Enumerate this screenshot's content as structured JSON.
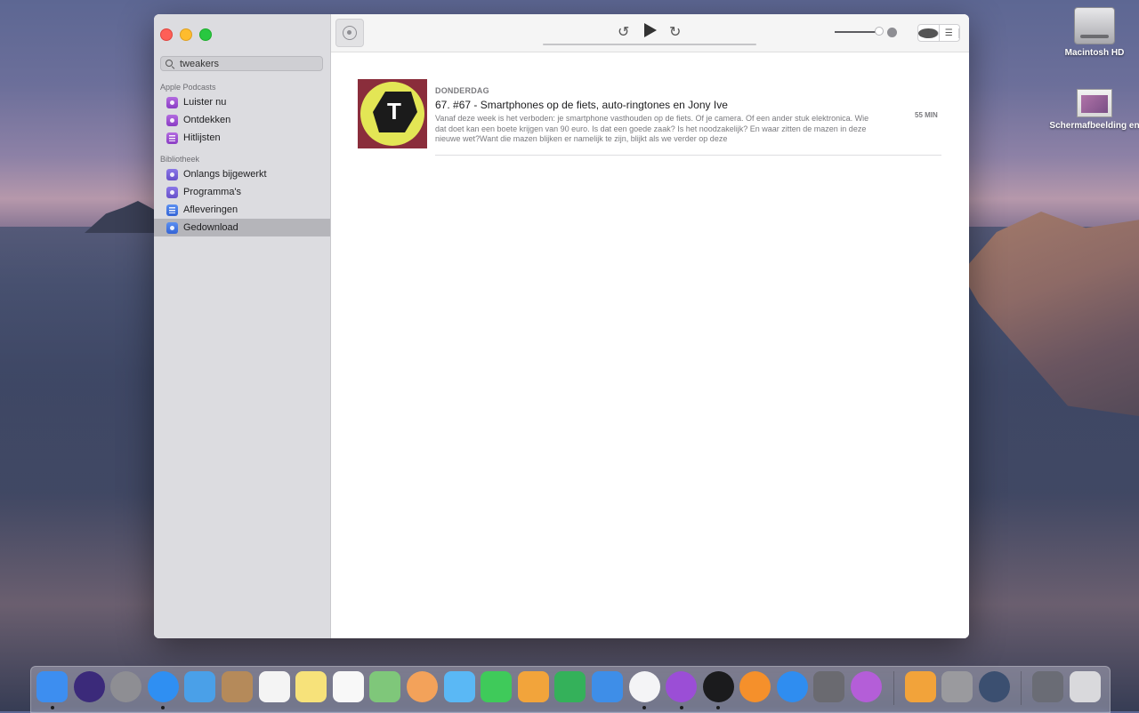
{
  "window": {
    "search_value": "tweakers",
    "sidebar": {
      "section_apple": "Apple Podcasts",
      "apple_items": [
        {
          "label": "Luister nu",
          "icon": "play-circle-icon"
        },
        {
          "label": "Ontdekken",
          "icon": "podcast-icon"
        },
        {
          "label": "Hitlijsten",
          "icon": "list-icon"
        }
      ],
      "section_library": "Bibliotheek",
      "library_items": [
        {
          "label": "Onlangs bijgewerkt",
          "icon": "clock-icon"
        },
        {
          "label": "Programma's",
          "icon": "shows-icon"
        },
        {
          "label": "Afleveringen",
          "icon": "episodes-icon"
        },
        {
          "label": "Gedownload",
          "icon": "download-icon",
          "selected": true
        }
      ]
    },
    "toolbar": {
      "skip_back_icon": "↺",
      "skip_forward_icon": "↻",
      "info_icon": "i",
      "list_icon": "☰"
    },
    "episode": {
      "day": "DONDERDAG",
      "title": "67. #67 - Smartphones op de fiets, auto-ringtones en Jony Ive",
      "description": "Vanaf deze week is het verboden: je smartphone vasthouden op de fiets. Of je camera. Of een ander stuk elektronica. Wie dat doet kan een boete krijgen van 90 euro. Is dat een goede zaak? Is het noodzakelijk? En waar zitten de mazen in deze nieuwe wet?Want die mazen blijken er namelijk te zijn, blijkt als we verder op deze",
      "duration": "55 MIN",
      "artwork_letter": "T"
    }
  },
  "desktop": {
    "icons": [
      {
        "label": "Macintosh HD",
        "icon": "hard-drive-icon"
      },
      {
        "label": "Schermafbeelding en",
        "icon": "screenshot-icon"
      }
    ]
  },
  "dock": {
    "apps": [
      {
        "name": "finder",
        "color": "#3d8ef0",
        "running": true
      },
      {
        "name": "siri",
        "color": "#3b2a7a",
        "running": false,
        "round": true
      },
      {
        "name": "launchpad",
        "color": "#8e8e93",
        "running": false,
        "round": true
      },
      {
        "name": "safari",
        "color": "#2f8ff2",
        "running": true,
        "round": true
      },
      {
        "name": "mail",
        "color": "#4aa0e8",
        "running": false
      },
      {
        "name": "contacts",
        "color": "#b58a5a",
        "running": false
      },
      {
        "name": "calendar",
        "color": "#f4f4f4",
        "running": false
      },
      {
        "name": "notes",
        "color": "#f7e27a",
        "running": false
      },
      {
        "name": "reminders",
        "color": "#f8f8f8",
        "running": false
      },
      {
        "name": "maps",
        "color": "#7fc77a",
        "running": false
      },
      {
        "name": "photos",
        "color": "#f3a25a",
        "running": false,
        "round": true
      },
      {
        "name": "messages",
        "color": "#5ab8f5",
        "running": false
      },
      {
        "name": "facetime",
        "color": "#3fca5a",
        "running": false
      },
      {
        "name": "pages",
        "color": "#f2a43b",
        "running": false
      },
      {
        "name": "numbers",
        "color": "#34b15a",
        "running": false
      },
      {
        "name": "keynote",
        "color": "#3e8ee8",
        "running": false
      },
      {
        "name": "music",
        "color": "#f4f4f6",
        "running": true,
        "round": true
      },
      {
        "name": "podcasts",
        "color": "#9b4ed6",
        "running": true,
        "round": true
      },
      {
        "name": "tv",
        "color": "#1b1b1d",
        "running": true,
        "round": true
      },
      {
        "name": "books",
        "color": "#f5902b",
        "running": false,
        "round": true
      },
      {
        "name": "app-store",
        "color": "#2f8df0",
        "running": false,
        "round": true
      },
      {
        "name": "system-preferences",
        "color": "#6a6a70",
        "running": false
      },
      {
        "name": "feedback-assistant",
        "color": "#b45ed8",
        "running": false,
        "round": true
      },
      {
        "name": "home-folder",
        "color": "#f2a33a",
        "running": false,
        "after_separator": true
      },
      {
        "name": "preview",
        "color": "#9a9a9e",
        "running": false
      },
      {
        "name": "quicktime",
        "color": "#3b4f70",
        "running": false,
        "round": true
      },
      {
        "name": "screenshots-stack",
        "color": "#6a6c75",
        "running": false,
        "after_separator": true
      },
      {
        "name": "trash",
        "color": "#d9d9dc",
        "running": false
      }
    ]
  }
}
